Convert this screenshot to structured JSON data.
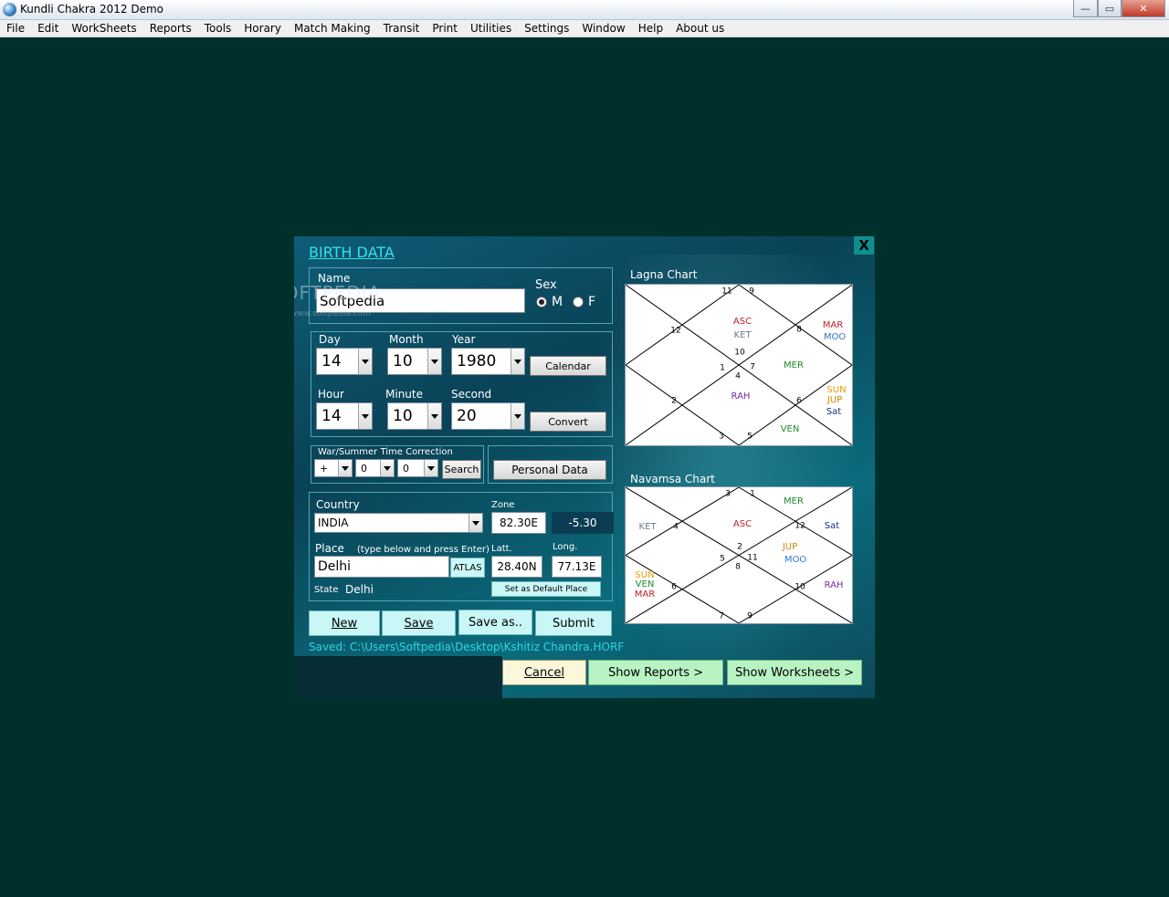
{
  "window": {
    "title": "Kundli Chakra 2012 Demo",
    "minimize": "—",
    "maximize": "▭",
    "close": "✕"
  },
  "menu": [
    "File",
    "Edit",
    "WorkSheets",
    "Reports",
    "Tools",
    "Horary",
    "Match Making",
    "Transit",
    "Print",
    "Utilities",
    "Settings",
    "Window",
    "Help",
    "About us"
  ],
  "watermark": {
    "text": "SOFTPEDIA",
    "sub": "www.softpedia.com"
  },
  "dialog": {
    "title": "BIRTH DATA",
    "close_label": "X",
    "name": {
      "label": "Name",
      "value": "Softpedia"
    },
    "sex": {
      "label": "Sex",
      "male": "M",
      "female": "F",
      "selected": "M"
    },
    "date": {
      "day_label": "Day",
      "day": "14",
      "month_label": "Month",
      "month": "10",
      "year_label": "Year",
      "year": "1980",
      "calendar_button": "Calendar"
    },
    "time": {
      "hour_label": "Hour",
      "hour": "14",
      "minute_label": "Minute",
      "minute": "10",
      "second_label": "Second",
      "second": "20",
      "convert_button": "Convert"
    },
    "war_time": {
      "label": "War/Summer Time Correction",
      "sign": "+",
      "hours": "0",
      "minutes": "0",
      "search_button": "Search"
    },
    "personal_data_button": "Personal Data",
    "location": {
      "country_label": "Country",
      "country": "INDIA",
      "zone_label": "Zone",
      "zone": "82.30E",
      "zone_offset": "-5.30",
      "place_label": "Place",
      "place_hint": "(type below and press Enter)",
      "place": "Delhi",
      "atlas_button": "ATLAS",
      "latt_label": "Latt.",
      "latt": "28.40N",
      "long_label": "Long.",
      "long": "77.13E",
      "state_label": "State",
      "state": "Delhi",
      "default_place_button": "Set as Default Place"
    },
    "buttons": {
      "new": "New",
      "save": "Save",
      "save_as": "Save as..",
      "submit": "Submit"
    },
    "saved_path": "Saved: C:\\Users\\Softpedia\\Desktop\\Kshitiz Chandra.HORF",
    "bottom_buttons": {
      "cancel": "Cancel",
      "show_reports": "Show Reports >",
      "show_worksheets": "Show Worksheets >"
    }
  },
  "lagna_chart": {
    "title": "Lagna Chart",
    "houses": [
      "11",
      "9",
      "12",
      "8",
      "10",
      "1",
      "7",
      "4",
      "2",
      "6",
      "3",
      "5"
    ],
    "planets": [
      {
        "label": "ASC",
        "color": "#c0202a"
      },
      {
        "label": "KET",
        "color": "#6b7b8c"
      },
      {
        "label": "MAR",
        "color": "#c0202a"
      },
      {
        "label": "MOO",
        "color": "#2a7ad0"
      },
      {
        "label": "MER",
        "color": "#1e8a2e"
      },
      {
        "label": "RAH",
        "color": "#7a2aa0"
      },
      {
        "label": "SUN",
        "color": "#e0a000"
      },
      {
        "label": "JUP",
        "color": "#c08a00"
      },
      {
        "label": "Sat",
        "color": "#1a2a8a"
      },
      {
        "label": "VEN",
        "color": "#1e8a2e"
      }
    ]
  },
  "navamsa_chart": {
    "title": "Navamsa Chart",
    "houses": [
      "3",
      "1",
      "4",
      "12",
      "2",
      "5",
      "11",
      "8",
      "6",
      "10",
      "7",
      "9"
    ],
    "planets": [
      {
        "label": "MER",
        "color": "#1e8a2e"
      },
      {
        "label": "KET",
        "color": "#6b7b8c"
      },
      {
        "label": "ASC",
        "color": "#c0202a"
      },
      {
        "label": "Sat",
        "color": "#1a2a8a"
      },
      {
        "label": "JUP",
        "color": "#c08a00"
      },
      {
        "label": "MOO",
        "color": "#2a7ad0"
      },
      {
        "label": "SUN",
        "color": "#e0a000"
      },
      {
        "label": "VEN",
        "color": "#1e8a2e"
      },
      {
        "label": "MAR",
        "color": "#c0202a"
      },
      {
        "label": "RAH",
        "color": "#7a2aa0"
      }
    ]
  }
}
